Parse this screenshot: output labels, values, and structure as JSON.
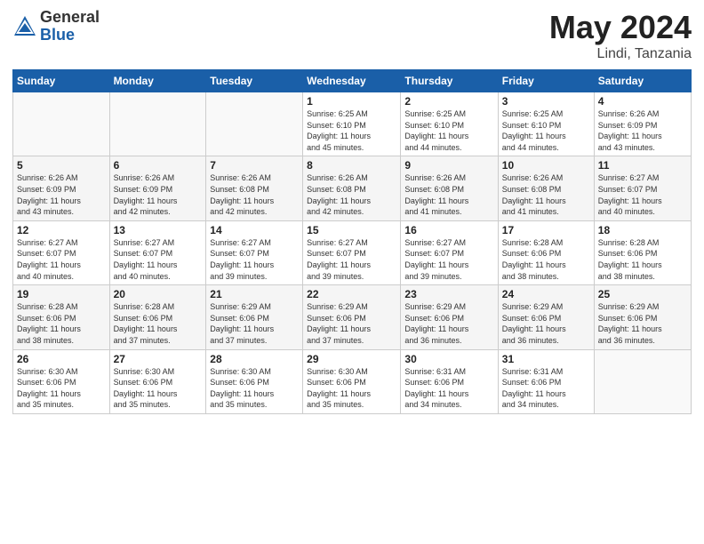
{
  "logo": {
    "general": "General",
    "blue": "Blue"
  },
  "title": {
    "month": "May 2024",
    "location": "Lindi, Tanzania"
  },
  "weekdays": [
    "Sunday",
    "Monday",
    "Tuesday",
    "Wednesday",
    "Thursday",
    "Friday",
    "Saturday"
  ],
  "weeks": [
    [
      {
        "day": "",
        "info": ""
      },
      {
        "day": "",
        "info": ""
      },
      {
        "day": "",
        "info": ""
      },
      {
        "day": "1",
        "info": "Sunrise: 6:25 AM\nSunset: 6:10 PM\nDaylight: 11 hours\nand 45 minutes."
      },
      {
        "day": "2",
        "info": "Sunrise: 6:25 AM\nSunset: 6:10 PM\nDaylight: 11 hours\nand 44 minutes."
      },
      {
        "day": "3",
        "info": "Sunrise: 6:25 AM\nSunset: 6:10 PM\nDaylight: 11 hours\nand 44 minutes."
      },
      {
        "day": "4",
        "info": "Sunrise: 6:26 AM\nSunset: 6:09 PM\nDaylight: 11 hours\nand 43 minutes."
      }
    ],
    [
      {
        "day": "5",
        "info": "Sunrise: 6:26 AM\nSunset: 6:09 PM\nDaylight: 11 hours\nand 43 minutes."
      },
      {
        "day": "6",
        "info": "Sunrise: 6:26 AM\nSunset: 6:09 PM\nDaylight: 11 hours\nand 42 minutes."
      },
      {
        "day": "7",
        "info": "Sunrise: 6:26 AM\nSunset: 6:08 PM\nDaylight: 11 hours\nand 42 minutes."
      },
      {
        "day": "8",
        "info": "Sunrise: 6:26 AM\nSunset: 6:08 PM\nDaylight: 11 hours\nand 42 minutes."
      },
      {
        "day": "9",
        "info": "Sunrise: 6:26 AM\nSunset: 6:08 PM\nDaylight: 11 hours\nand 41 minutes."
      },
      {
        "day": "10",
        "info": "Sunrise: 6:26 AM\nSunset: 6:08 PM\nDaylight: 11 hours\nand 41 minutes."
      },
      {
        "day": "11",
        "info": "Sunrise: 6:27 AM\nSunset: 6:07 PM\nDaylight: 11 hours\nand 40 minutes."
      }
    ],
    [
      {
        "day": "12",
        "info": "Sunrise: 6:27 AM\nSunset: 6:07 PM\nDaylight: 11 hours\nand 40 minutes."
      },
      {
        "day": "13",
        "info": "Sunrise: 6:27 AM\nSunset: 6:07 PM\nDaylight: 11 hours\nand 40 minutes."
      },
      {
        "day": "14",
        "info": "Sunrise: 6:27 AM\nSunset: 6:07 PM\nDaylight: 11 hours\nand 39 minutes."
      },
      {
        "day": "15",
        "info": "Sunrise: 6:27 AM\nSunset: 6:07 PM\nDaylight: 11 hours\nand 39 minutes."
      },
      {
        "day": "16",
        "info": "Sunrise: 6:27 AM\nSunset: 6:07 PM\nDaylight: 11 hours\nand 39 minutes."
      },
      {
        "day": "17",
        "info": "Sunrise: 6:28 AM\nSunset: 6:06 PM\nDaylight: 11 hours\nand 38 minutes."
      },
      {
        "day": "18",
        "info": "Sunrise: 6:28 AM\nSunset: 6:06 PM\nDaylight: 11 hours\nand 38 minutes."
      }
    ],
    [
      {
        "day": "19",
        "info": "Sunrise: 6:28 AM\nSunset: 6:06 PM\nDaylight: 11 hours\nand 38 minutes."
      },
      {
        "day": "20",
        "info": "Sunrise: 6:28 AM\nSunset: 6:06 PM\nDaylight: 11 hours\nand 37 minutes."
      },
      {
        "day": "21",
        "info": "Sunrise: 6:29 AM\nSunset: 6:06 PM\nDaylight: 11 hours\nand 37 minutes."
      },
      {
        "day": "22",
        "info": "Sunrise: 6:29 AM\nSunset: 6:06 PM\nDaylight: 11 hours\nand 37 minutes."
      },
      {
        "day": "23",
        "info": "Sunrise: 6:29 AM\nSunset: 6:06 PM\nDaylight: 11 hours\nand 36 minutes."
      },
      {
        "day": "24",
        "info": "Sunrise: 6:29 AM\nSunset: 6:06 PM\nDaylight: 11 hours\nand 36 minutes."
      },
      {
        "day": "25",
        "info": "Sunrise: 6:29 AM\nSunset: 6:06 PM\nDaylight: 11 hours\nand 36 minutes."
      }
    ],
    [
      {
        "day": "26",
        "info": "Sunrise: 6:30 AM\nSunset: 6:06 PM\nDaylight: 11 hours\nand 35 minutes."
      },
      {
        "day": "27",
        "info": "Sunrise: 6:30 AM\nSunset: 6:06 PM\nDaylight: 11 hours\nand 35 minutes."
      },
      {
        "day": "28",
        "info": "Sunrise: 6:30 AM\nSunset: 6:06 PM\nDaylight: 11 hours\nand 35 minutes."
      },
      {
        "day": "29",
        "info": "Sunrise: 6:30 AM\nSunset: 6:06 PM\nDaylight: 11 hours\nand 35 minutes."
      },
      {
        "day": "30",
        "info": "Sunrise: 6:31 AM\nSunset: 6:06 PM\nDaylight: 11 hours\nand 34 minutes."
      },
      {
        "day": "31",
        "info": "Sunrise: 6:31 AM\nSunset: 6:06 PM\nDaylight: 11 hours\nand 34 minutes."
      },
      {
        "day": "",
        "info": ""
      }
    ]
  ]
}
